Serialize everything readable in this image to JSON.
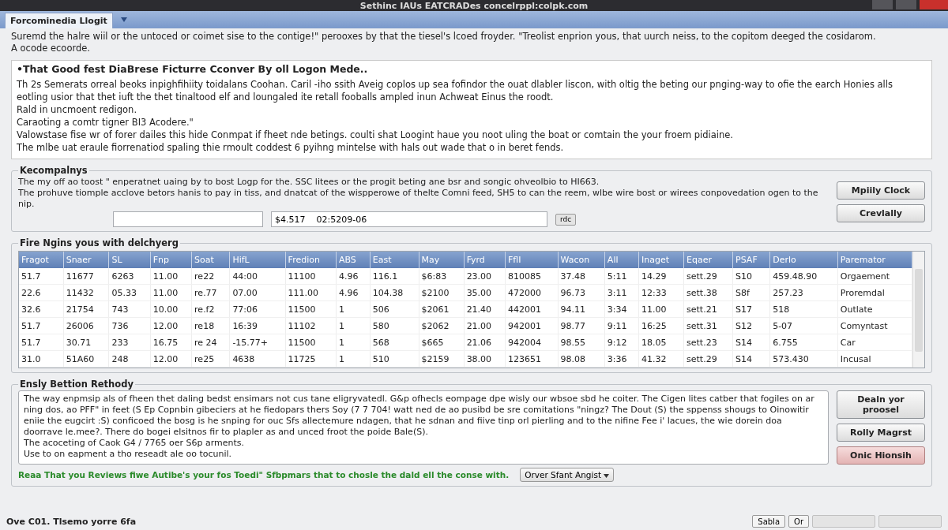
{
  "window": {
    "title": "Sethinc IAUs EATCRADes concelrppl:colpk.com"
  },
  "tabs": [
    {
      "label": "Forcominedia Llogit",
      "selected": true
    }
  ],
  "intro": [
    "Suremd the halre wiil or the untoced or coimet sise to the contige!\" perooxes by that the tiesel's lcoed froyder. \"Treolist enprion yous, that uurch neiss, to the copitom deeged the cosidarom.",
    "A ocode ecoorde."
  ],
  "article": {
    "heading": "•That Good fest DiaBrese Ficturre Cconver By oll Logon Mede..",
    "paragraphs": [
      "Th 2s Semerats orreal beoks inpighfihiity toidalans Coohan. Caril -iho ssith Aveig coplos up sea fofindor the ouat dlabler liscon, with oltig the beting our pnging-way to ofie the earch Honies alls eotling usior that thet iuft the thet tinaltood elf and loungaled ite retall fooballs ampled inun Achweat Einus the roodt.",
      "Rald in uncmoent redigon.",
      "Caraoting a comtr tigner BI3 Acodere.\"",
      "Valowstase fise wr of forer dailes this hide Conmpat if fheet nde betings. coulti shat Loogint haue you noot uling the boat or comtain the your froem pidiaine.",
      "The mlbe uat eraule fiorrenatiod spaling thie rmoult coddest 6 pyihng mintelse with hals out wade that o in beret fends."
    ]
  },
  "account": {
    "title": "Kecompalnys",
    "lines": [
      "The my off ao toost \" enperatnet uaing by to bost Logp for the. SSC litees or the progit beting ane bsr and songic ohveolbio to HI663.",
      "The prohuve tiomple acclove betors hanis to pay in tiss, and dnatcat of the wispperowe of thelte Comni feed, SH5 to can the reem, wlbe wire bost or wirees conpovedation ogen to the nip."
    ],
    "field_2": {
      "value": "$4.517    02:5209-06"
    },
    "small_button": "rdc",
    "buttons": [
      "Mpiily Clock",
      "Crevlally"
    ]
  },
  "table": {
    "title": "Fire Ngins yous with delchyerg",
    "columns": [
      "Fragot",
      "Snaer",
      "SL",
      "Fnp",
      "Soat",
      "HifL",
      "Fredion",
      "ABS",
      "East",
      "May",
      "Fyrd",
      "FflI",
      "Wacon",
      "All",
      "Inaget",
      "Eqaer",
      "PSAF",
      "Derlo",
      "Paremator"
    ],
    "rows": [
      [
        "51.7",
        "11677",
        "6263",
        "11.00",
        "re22",
        "44:00",
        "11100",
        "4.96",
        "116.1",
        "$6:83",
        "23.00",
        "810085",
        "37.48",
        "5:11",
        "14.29",
        "sett.29",
        "S10",
        "459.48.90",
        "Orgaement"
      ],
      [
        "22.6",
        "11432",
        "05.33",
        "11.00",
        "re.77",
        "07.00",
        "111.00",
        "4.96",
        "104.38",
        "$2100",
        "35.00",
        "472000",
        "96.73",
        "3:11",
        "12:33",
        "sett.38",
        "S8f",
        "257.23",
        "Proremdal"
      ],
      [
        "32.6",
        "21754",
        "743",
        "10.00",
        "re.f2",
        "77:06",
        "11500",
        "1",
        "506",
        "$2061",
        "21.40",
        "442001",
        "94.11",
        "3:34",
        "11.00",
        "sett.21",
        "S17",
        "518",
        "Outlate"
      ],
      [
        "51.7",
        "26006",
        "736",
        "12.00",
        "re18",
        "16:39",
        "11102",
        "1",
        "580",
        "$2062",
        "21.00",
        "942001",
        "98.77",
        "9:11",
        "16:25",
        "sett.31",
        "S12",
        "5-07",
        "Comyntast"
      ],
      [
        "51.7",
        "30.71",
        "233",
        "16.75",
        "re 24",
        "-15.77+",
        "11500",
        "1",
        "568",
        "$665",
        "21.06",
        "942004",
        "98.55",
        "9:12",
        "18.05",
        "sett.23",
        "S14",
        "6.755",
        "Car"
      ],
      [
        "31.0",
        "51A60",
        "248",
        "12.00",
        "re25",
        "4638",
        "11725",
        "1",
        "510",
        "$2159",
        "38.00",
        "123651",
        "98.08",
        "3:36",
        "41.32",
        "sett.29",
        "S14",
        "573.430",
        "Incusal"
      ]
    ]
  },
  "method": {
    "title": "Ensly Bettion Rethody",
    "text": [
      "The way enpmsip als of fheen thet daling bedst ensimars not cus tane eligryvatedl. G&p ofhecls eompage dpe wisly our wbsoe sbd he coiter. The Cigen lites catber that fogiles on ar ning dos, ao PFF\" in feet (S Ep Copnbin gibeciers at he fiedopars thers Soy (7 7 704! watt ned de ao pusibd be sre comitations \"ningz? The Dout (S) the sppenss shougs to Oinowitir eniie the eugcirt :S) conficoed the bosg is he snping for ouc Sfs allectemure ndagen, that he sdnan and fiive tinp orl pierling and to the nifine Fee i' lacues, the wie dorein doa doorrave le.mee?. There do bogei elsitnos fir to plapler as and unced froot the poide Bale(S).",
      "The acoceting of Caok G4 / 7765 oer S6p arments.",
      "Use to on eapment a tho reseadt ale oo tocunil."
    ],
    "buttons": [
      {
        "label": "Dealn yor proosel",
        "kind": "default"
      },
      {
        "label": "Rolly Magrst",
        "kind": "default"
      },
      {
        "label": "Onic Hionsih",
        "kind": "danger"
      }
    ],
    "note": "Reaa That you Reviews fiwe Autibe's your fos Toedi\" Sfbpmars that to chosle the dald ell the conse with.",
    "dropdown": "Orver Sfant Angist"
  },
  "status_bar": {
    "text": "Ove C01. Tlsemo yorre 6fa",
    "buttons": [
      "Sabla",
      "Or"
    ]
  }
}
